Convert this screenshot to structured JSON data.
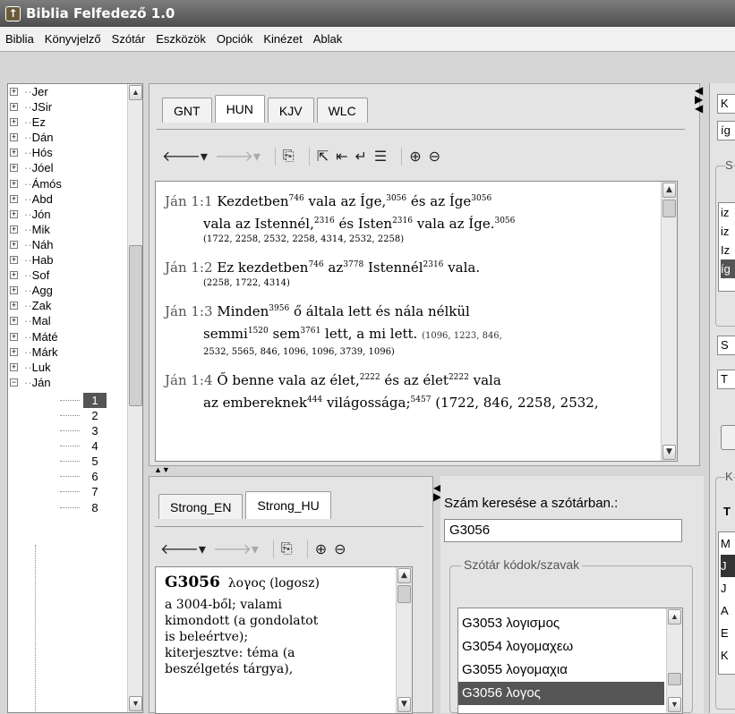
{
  "window": {
    "title": "Biblia Felfedező 1.0",
    "icon": "bible-app-icon"
  },
  "menu": [
    "Biblia",
    "Könyvjelző",
    "Szótár",
    "Eszközök",
    "Opciók",
    "Kinézet",
    "Ablak"
  ],
  "tree": {
    "books": [
      "Jer",
      "JSir",
      "Ez",
      "Dán",
      "Hós",
      "Jóel",
      "Ámós",
      "Abd",
      "Jón",
      "Mik",
      "Náh",
      "Hab",
      "Sof",
      "Agg",
      "Zak",
      "Mal",
      "Máté",
      "Márk",
      "Luk"
    ],
    "open_book": "Ján",
    "chapters": [
      "1",
      "2",
      "3",
      "4",
      "5",
      "6",
      "7",
      "8"
    ],
    "selected_chapter": "1"
  },
  "bible_tabs": [
    "GNT",
    "HUN",
    "KJV",
    "WLC"
  ],
  "bible_active_tab": "HUN",
  "verses": [
    {
      "ref": "Ján 1:1",
      "line1": [
        [
          "Kezdetben",
          "746"
        ],
        [
          "vala az Íge,",
          "3056"
        ],
        [
          "és az Íge",
          "3056"
        ]
      ],
      "line2": [
        [
          "vala az Istennél,",
          "2316"
        ],
        [
          "és Isten",
          "2316"
        ],
        [
          "vala az Íge.",
          "3056"
        ]
      ],
      "codes": "(1722, 2258, 2532, 2258, 4314, 2532, 2258)"
    },
    {
      "ref": "Ján 1:2",
      "line1": [
        [
          "Ez kezdetben",
          "746"
        ],
        [
          "az",
          "3778"
        ],
        [
          "Istennél",
          "2316"
        ],
        [
          "vala.",
          ""
        ]
      ],
      "codes": "(2258, 1722, 4314)"
    },
    {
      "ref": "Ján 1:3",
      "line1": [
        [
          "Minden",
          "3956"
        ],
        [
          "ő általa lett és nála nélkül",
          ""
        ]
      ],
      "line2": [
        [
          "semmi",
          "1520"
        ],
        [
          "sem",
          "3761"
        ],
        [
          "lett, a mi lett.",
          ""
        ]
      ],
      "codes_inline": "(1096, 1223, 846,",
      "codes": "2532, 5565, 846, 1096, 1096, 3739, 1096)"
    },
    {
      "ref": "Ján 1:4",
      "line1": [
        [
          "Ő benne vala az élet,",
          "2222"
        ],
        [
          "és az élet",
          "2222"
        ],
        [
          "vala",
          ""
        ]
      ],
      "line2": [
        [
          "az embereknek",
          "444"
        ],
        [
          "világossága;",
          "5457"
        ],
        [
          "(1722, 846, 2258, 2532,",
          ""
        ]
      ]
    }
  ],
  "dict_tabs": [
    "Strong_EN",
    "Strong_HU"
  ],
  "dict_active_tab": "Strong_HU",
  "dict_entry": {
    "code": "G3056",
    "greek": "λογος",
    "translit": "(logosz)",
    "lines": [
      "a 3004-ből; valami",
      "kimondott (a gondolatot",
      "is beleértve);",
      "kiterjesztve: téma (a",
      "beszélgetés tárgya),"
    ]
  },
  "search": {
    "label": "Szám keresése a szótárban.:",
    "value": "G3056",
    "group_label": "Szótár kódok/szavak",
    "items": [
      {
        "code": "G3053",
        "word": "λογισμος"
      },
      {
        "code": "G3054",
        "word": "λογομαχεω"
      },
      {
        "code": "G3055",
        "word": "λογομαχια"
      },
      {
        "code": "G3056",
        "word": "λογος"
      }
    ],
    "selected": "G3056"
  },
  "right_panel": {
    "field1": "K",
    "field2": "íg",
    "group_s": "S",
    "list": [
      "iz",
      "iz",
      "Iz",
      "íg"
    ],
    "combo1": "S",
    "combo2": "T",
    "group_k": "K",
    "header": "T",
    "rows": [
      "M",
      "J",
      "J",
      "A",
      "E",
      "K"
    ]
  }
}
